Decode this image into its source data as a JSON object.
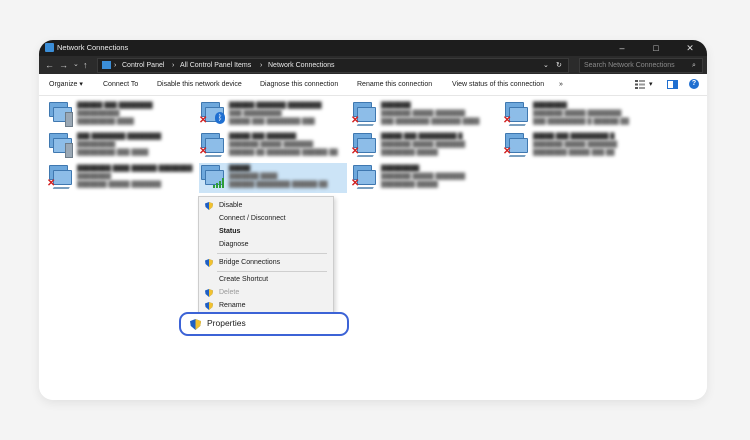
{
  "window": {
    "title": "Network Connections",
    "minimize": "–",
    "maximize": "□",
    "close": "✕"
  },
  "address": {
    "back": "←",
    "forward": "→",
    "recent": "⌄",
    "up": "↑",
    "breadcrumbs": [
      "Control Panel",
      "All Control Panel Items",
      "Network Connections"
    ],
    "separator": "›",
    "dropdown": "⌄",
    "refresh": "↻",
    "search_placeholder": "Search Network Connections",
    "search_icon": "⌕"
  },
  "toolbar": {
    "items": [
      "Organize ▾",
      "Connect To",
      "Disable this network device",
      "Diagnose this connection",
      "Rename this connection",
      "View status of this connection",
      "»"
    ],
    "view_dropdown": "▾",
    "help": "?"
  },
  "connections": [
    {
      "name": "blurred",
      "badge": "server-icon"
    },
    {
      "name": "blurred",
      "badge": "bluetooth-icon"
    },
    {
      "name": "blurred",
      "badge": "x-icon"
    },
    {
      "name": "blurred",
      "badge": "x-icon"
    },
    {
      "name": "blurred",
      "badge": "server-icon"
    },
    {
      "name": "blurred",
      "badge": "x-icon"
    },
    {
      "name": "blurred",
      "badge": "x-icon"
    },
    {
      "name": "blurred",
      "badge": "x-icon"
    },
    {
      "name": "blurred",
      "badge": "x-icon"
    },
    {
      "name": "blurred",
      "badge": "wifi-icon"
    },
    {
      "name": "blurred",
      "badge": "x-icon"
    }
  ],
  "context_menu": {
    "disable": "Disable",
    "connect": "Connect / Disconnect",
    "status": "Status",
    "diagnose": "Diagnose",
    "bridge": "Bridge Connections",
    "shortcut": "Create Shortcut",
    "delete": "Delete",
    "rename": "Rename",
    "properties": "Properties"
  },
  "colors": {
    "accent": "#3c63d6",
    "selection": "#cce4f7",
    "titlebar": "#1d1d1d"
  }
}
